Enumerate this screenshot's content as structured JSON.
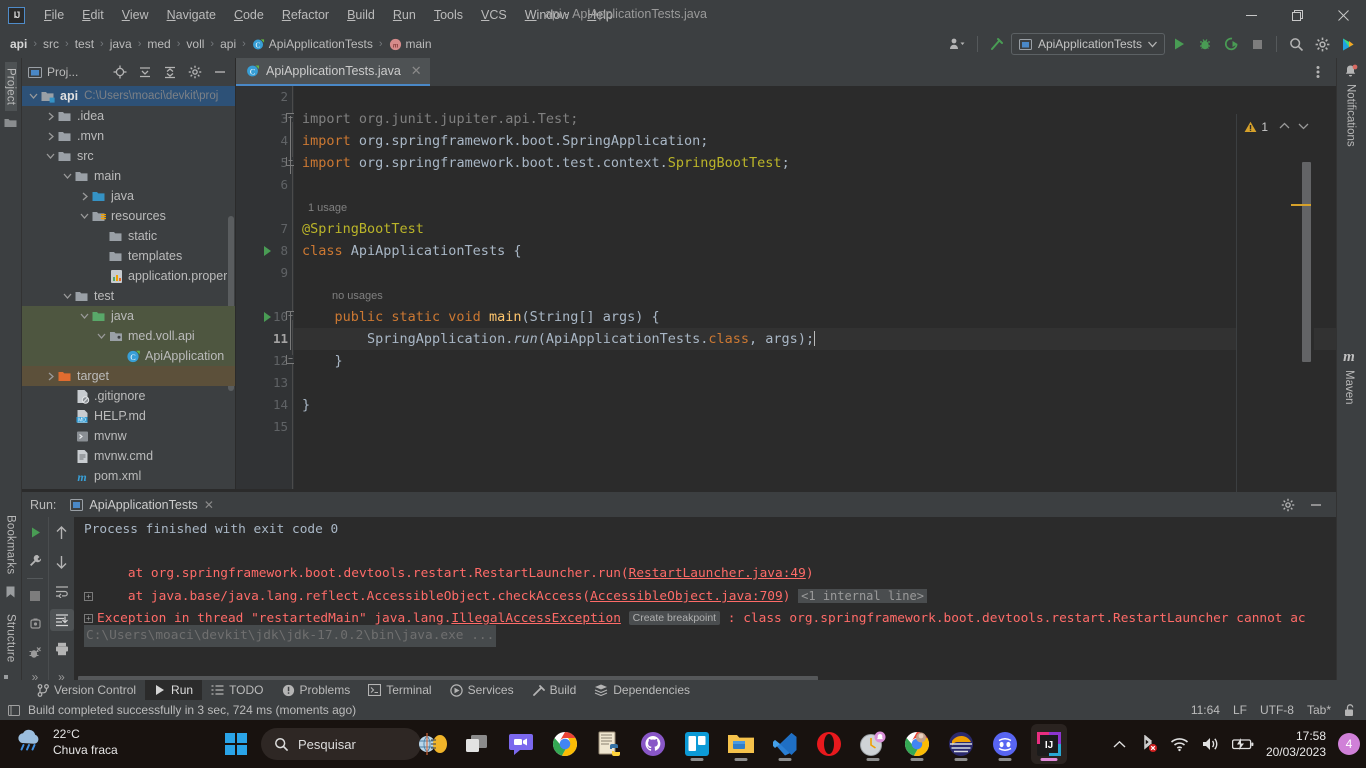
{
  "titlebar": {
    "app_icon": "intellij-logo-icon",
    "window_title": "api - ApiApplicationTests.java",
    "menus": [
      {
        "label": "File"
      },
      {
        "label": "Edit"
      },
      {
        "label": "View"
      },
      {
        "label": "Navigate"
      },
      {
        "label": "Code"
      },
      {
        "label": "Refactor"
      },
      {
        "label": "Build"
      },
      {
        "label": "Run"
      },
      {
        "label": "Tools"
      },
      {
        "label": "VCS"
      },
      {
        "label": "Window"
      },
      {
        "label": "Help"
      }
    ],
    "minimize": "—",
    "maximize": "❐",
    "close": "✕"
  },
  "navbar": {
    "breadcrumbs": [
      {
        "label": "api",
        "icon": "none",
        "bold": true
      },
      {
        "label": "src",
        "icon": "none",
        "bold": false
      },
      {
        "label": "test",
        "icon": "none",
        "bold": false
      },
      {
        "label": "java",
        "icon": "none",
        "bold": false
      },
      {
        "label": "med",
        "icon": "none",
        "bold": false
      },
      {
        "label": "voll",
        "icon": "none",
        "bold": false
      },
      {
        "label": "api",
        "icon": "none",
        "bold": false
      },
      {
        "label": "ApiApplicationTests",
        "icon": "java-class-icon",
        "bold": false
      },
      {
        "label": "main",
        "icon": "method-icon",
        "bold": false
      }
    ],
    "separator": "›",
    "run_config": "ApiApplicationTests",
    "buttons": [
      {
        "name": "account-icon"
      },
      {
        "name": "build-hammer-icon"
      },
      {
        "name": "run-button"
      },
      {
        "name": "debug-button"
      },
      {
        "name": "run-coverage-button"
      },
      {
        "name": "stop-button"
      },
      {
        "name": "search-everywhere-icon"
      },
      {
        "name": "settings-gear-icon"
      },
      {
        "name": "ide-assistant-icon"
      }
    ]
  },
  "left_strip": {
    "top_label": "Project",
    "bottom_labels": [
      "Bookmarks",
      "Structure"
    ]
  },
  "right_strip": {
    "labels": [
      "Notifications",
      "Maven"
    ]
  },
  "project_panel": {
    "title": "Proj...",
    "tools": [
      "locate-icon",
      "expand-all-icon",
      "collapse-all-icon",
      "settings-gear-icon",
      "hide-icon"
    ],
    "tree": [
      {
        "label": "api",
        "path": "C:\\Users\\moaci\\devkit\\proj",
        "depth": 0,
        "arrow": "down",
        "icon": "module-folder-icon",
        "state": "selected",
        "bold": true
      },
      {
        "label": ".idea",
        "path": "",
        "depth": 1,
        "arrow": "right",
        "icon": "folder-icon",
        "state": "",
        "bold": false
      },
      {
        "label": ".mvn",
        "path": "",
        "depth": 1,
        "arrow": "right",
        "icon": "folder-icon",
        "state": "",
        "bold": false
      },
      {
        "label": "src",
        "path": "",
        "depth": 1,
        "arrow": "down",
        "icon": "folder-icon",
        "state": "",
        "bold": false
      },
      {
        "label": "main",
        "path": "",
        "depth": 2,
        "arrow": "down",
        "icon": "folder-icon",
        "state": "",
        "bold": false
      },
      {
        "label": "java",
        "path": "",
        "depth": 3,
        "arrow": "right",
        "icon": "source-folder-icon",
        "state": "",
        "bold": false
      },
      {
        "label": "resources",
        "path": "",
        "depth": 3,
        "arrow": "down",
        "icon": "resource-folder-icon",
        "state": "",
        "bold": false
      },
      {
        "label": "static",
        "path": "",
        "depth": 4,
        "arrow": "none",
        "icon": "folder-icon",
        "state": "",
        "bold": false
      },
      {
        "label": "templates",
        "path": "",
        "depth": 4,
        "arrow": "none",
        "icon": "folder-icon",
        "state": "",
        "bold": false
      },
      {
        "label": "application.proper",
        "path": "",
        "depth": 4,
        "arrow": "none",
        "icon": "properties-file-icon",
        "state": "",
        "bold": false
      },
      {
        "label": "test",
        "path": "",
        "depth": 2,
        "arrow": "down",
        "icon": "folder-icon",
        "state": "",
        "bold": false
      },
      {
        "label": "java",
        "path": "",
        "depth": 3,
        "arrow": "down",
        "icon": "test-source-folder-icon",
        "state": "hl-green",
        "bold": false
      },
      {
        "label": "med.voll.api",
        "path": "",
        "depth": 4,
        "arrow": "down",
        "icon": "package-icon",
        "state": "hl-green",
        "bold": false
      },
      {
        "label": "ApiApplication",
        "path": "",
        "depth": 5,
        "arrow": "none",
        "icon": "java-class-icon",
        "state": "hl-green",
        "bold": false
      },
      {
        "label": "target",
        "path": "",
        "depth": 1,
        "arrow": "right",
        "icon": "excluded-folder-icon",
        "state": "hl-brown",
        "bold": false
      },
      {
        "label": ".gitignore",
        "path": "",
        "depth": 2,
        "arrow": "none",
        "icon": "gitignore-file-icon",
        "state": "",
        "bold": false
      },
      {
        "label": "HELP.md",
        "path": "",
        "depth": 2,
        "arrow": "none",
        "icon": "markdown-file-icon",
        "state": "",
        "bold": false
      },
      {
        "label": "mvnw",
        "path": "",
        "depth": 2,
        "arrow": "none",
        "icon": "shell-script-icon",
        "state": "",
        "bold": false
      },
      {
        "label": "mvnw.cmd",
        "path": "",
        "depth": 2,
        "arrow": "none",
        "icon": "cmd-file-icon",
        "state": "",
        "bold": false
      },
      {
        "label": "pom.xml",
        "path": "",
        "depth": 2,
        "arrow": "none",
        "icon": "maven-pom-icon",
        "state": "",
        "bold": false
      }
    ]
  },
  "editor": {
    "tab": {
      "label": "ApiApplicationTests.java",
      "icon": "java-class-icon",
      "close": "✕"
    },
    "options_icon": "more-options-icon",
    "warning_count": "1",
    "warning_icon": "warning-triangle-icon",
    "nav_up": "⌃",
    "nav_down": "⌄",
    "lines": [
      {
        "num": "2",
        "tokens": [],
        "hint": "",
        "run": false,
        "fold": "",
        "cur": false
      },
      {
        "num": "3",
        "tokens": [
          {
            "t": "import ",
            "c": "gry"
          },
          {
            "t": "org.junit.jupiter.api.Test;",
            "c": "gry"
          }
        ],
        "hint": "",
        "run": false,
        "fold": "top",
        "cur": false
      },
      {
        "num": "4",
        "tokens": [
          {
            "t": "import",
            "c": "kw"
          },
          {
            "t": " org.springframework.boot.SpringApplication;",
            "c": "cls"
          }
        ],
        "hint": "",
        "run": false,
        "fold": "",
        "cur": false
      },
      {
        "num": "5",
        "tokens": [
          {
            "t": "import",
            "c": "kw"
          },
          {
            "t": " org.springframework.boot.test.context.",
            "c": "cls"
          },
          {
            "t": "SpringBootTest",
            "c": "ann"
          },
          {
            "t": ";",
            "c": "cls"
          }
        ],
        "hint": "",
        "run": false,
        "fold": "bottom",
        "cur": false
      },
      {
        "num": "6",
        "tokens": [],
        "hint": "",
        "run": false,
        "fold": "",
        "cur": false
      },
      {
        "num": "",
        "tokens": [],
        "hint": "1 usage",
        "run": false,
        "fold": "",
        "cur": false
      },
      {
        "num": "7",
        "tokens": [
          {
            "t": "@SpringBootTest",
            "c": "ann"
          }
        ],
        "hint": "",
        "run": false,
        "fold": "",
        "cur": false
      },
      {
        "num": "8",
        "tokens": [
          {
            "t": "class",
            "c": "kw"
          },
          {
            "t": " ApiApplicationTests {",
            "c": "cls"
          }
        ],
        "hint": "",
        "run": true,
        "fold": "",
        "cur": false
      },
      {
        "num": "9",
        "tokens": [],
        "hint": "",
        "run": false,
        "fold": "",
        "cur": false
      },
      {
        "num": "",
        "tokens": [],
        "hint": "no usages",
        "run": false,
        "fold": "",
        "cur": false,
        "indent": true
      },
      {
        "num": "10",
        "tokens": [
          {
            "t": "    ",
            "c": "cls"
          },
          {
            "t": "public static void ",
            "c": "kw"
          },
          {
            "t": "main",
            "c": "mth"
          },
          {
            "t": "(String[] args) {",
            "c": "cls"
          }
        ],
        "hint": "",
        "run": true,
        "fold": "top2",
        "cur": false
      },
      {
        "num": "11",
        "tokens": [
          {
            "t": "        SpringApplication.",
            "c": "cls"
          },
          {
            "t": "run",
            "c": "itl"
          },
          {
            "t": "(ApiApplicationTests.",
            "c": "cls"
          },
          {
            "t": "class",
            "c": "kw"
          },
          {
            "t": ", args);",
            "c": "cls"
          }
        ],
        "hint": "",
        "run": false,
        "fold": "",
        "cur": true,
        "caret": true
      },
      {
        "num": "12",
        "tokens": [
          {
            "t": "    }",
            "c": "cls"
          }
        ],
        "hint": "",
        "run": false,
        "fold": "bottom2",
        "cur": false
      },
      {
        "num": "13",
        "tokens": [],
        "hint": "",
        "run": false,
        "fold": "",
        "cur": false
      },
      {
        "num": "14",
        "tokens": [
          {
            "t": "}",
            "c": "cls"
          }
        ],
        "hint": "",
        "run": false,
        "fold": "",
        "cur": false
      },
      {
        "num": "15",
        "tokens": [],
        "hint": "",
        "run": false,
        "fold": "",
        "cur": false
      }
    ]
  },
  "run_panel": {
    "label": "Run:",
    "tab": "ApiApplicationTests",
    "tab_close": "✕",
    "tab_icon": "run-config-icon",
    "header_buttons": [
      "settings-gear-icon",
      "hide-panel-icon"
    ],
    "gutter1": [
      "rerun-button",
      "wrench-settings-button",
      "stop-button",
      "dump-threads-button",
      "kill-process-button",
      "more-button"
    ],
    "gutter2": [
      "scroll-up-button",
      "scroll-down-button",
      "soft-wrap-button",
      "scroll-to-end-button",
      "print-button",
      "more-button"
    ],
    "console": [
      {
        "type": "faded",
        "text": "C:\\Users\\moaci\\devkit\\jdk\\jdk-17.0.2\\bin\\java.exe ..."
      },
      {
        "type": "exception",
        "expand": true,
        "pre": "Exception in thread \"restartedMain\" java.lang.",
        "link": "IllegalAccessException",
        "chip": "Create breakpoint",
        "post": " : class org.springframework.boot.devtools.restart.RestartLauncher cannot ac"
      },
      {
        "type": "stack",
        "expand": true,
        "pre": "    at java.base/java.lang.reflect.AccessibleObject.checkAccess(",
        "link": "AccessibleObject.java:709",
        "post": ")",
        "chip2": "<1 internal line>"
      },
      {
        "type": "stack",
        "expand": false,
        "pre": "    at org.springframework.boot.devtools.restart.RestartLauncher.run(",
        "link": "RestartLauncher.java:49",
        "post": ")"
      },
      {
        "type": "blank",
        "text": ""
      },
      {
        "type": "plain",
        "text": "Process finished with exit code 0"
      }
    ]
  },
  "bottom_tabs": [
    {
      "label": "Version Control",
      "icon": "branch-icon",
      "active": false
    },
    {
      "label": "Run",
      "icon": "run-icon",
      "active": true
    },
    {
      "label": "TODO",
      "icon": "todo-list-icon",
      "active": false
    },
    {
      "label": "Problems",
      "icon": "problems-icon",
      "active": false
    },
    {
      "label": "Terminal",
      "icon": "terminal-icon",
      "active": false
    },
    {
      "label": "Services",
      "icon": "services-icon",
      "active": false
    },
    {
      "label": "Build",
      "icon": "build-hammer-icon",
      "active": false
    },
    {
      "label": "Dependencies",
      "icon": "dependencies-icon",
      "active": false
    }
  ],
  "statusbar": {
    "icon": "build-status-icon",
    "message": "Build completed successfully in 3 sec, 724 ms (moments ago)",
    "caret_position": "11:64",
    "line_separator": "LF",
    "encoding": "UTF-8",
    "indent": "Tab*",
    "lock_icon": "unlocked-icon"
  },
  "taskbar": {
    "weather": {
      "temperature": "22°C",
      "condition": "Chuva fraca",
      "icon": "rain-cloud-icon"
    },
    "start_icon": "windows-start-icon",
    "search_placeholder": "Pesquisar",
    "search_icon": "search-icon",
    "apps": [
      {
        "name": "widgets-icon",
        "running": false,
        "active": false
      },
      {
        "name": "task-view-icon",
        "running": false,
        "active": false
      },
      {
        "name": "teams-chat-icon",
        "running": false,
        "active": false
      },
      {
        "name": "chrome-icon",
        "running": false,
        "active": false
      },
      {
        "name": "python-editor-icon",
        "running": false,
        "active": false
      },
      {
        "name": "github-desktop-icon",
        "running": false,
        "active": false
      },
      {
        "name": "trello-icon",
        "running": true,
        "active": false
      },
      {
        "name": "file-explorer-icon",
        "running": true,
        "active": false
      },
      {
        "name": "vscode-icon",
        "running": true,
        "active": false
      },
      {
        "name": "opera-icon",
        "running": false,
        "active": false
      },
      {
        "name": "clock-alarm-icon",
        "running": true,
        "active": false
      },
      {
        "name": "chrome-profile-icon",
        "running": true,
        "active": false
      },
      {
        "name": "edge-icon",
        "running": true,
        "active": false
      },
      {
        "name": "discord-icon",
        "running": true,
        "active": false
      },
      {
        "name": "intellij-idea-icon",
        "running": true,
        "active": true
      }
    ],
    "tray": {
      "expand_icon": "chevron-up-icon",
      "items": [
        "bluetooth-off-icon",
        "wifi-icon",
        "volume-icon",
        "battery-charging-icon"
      ],
      "time": "17:58",
      "date": "20/03/2023",
      "notification_count": "4"
    }
  }
}
